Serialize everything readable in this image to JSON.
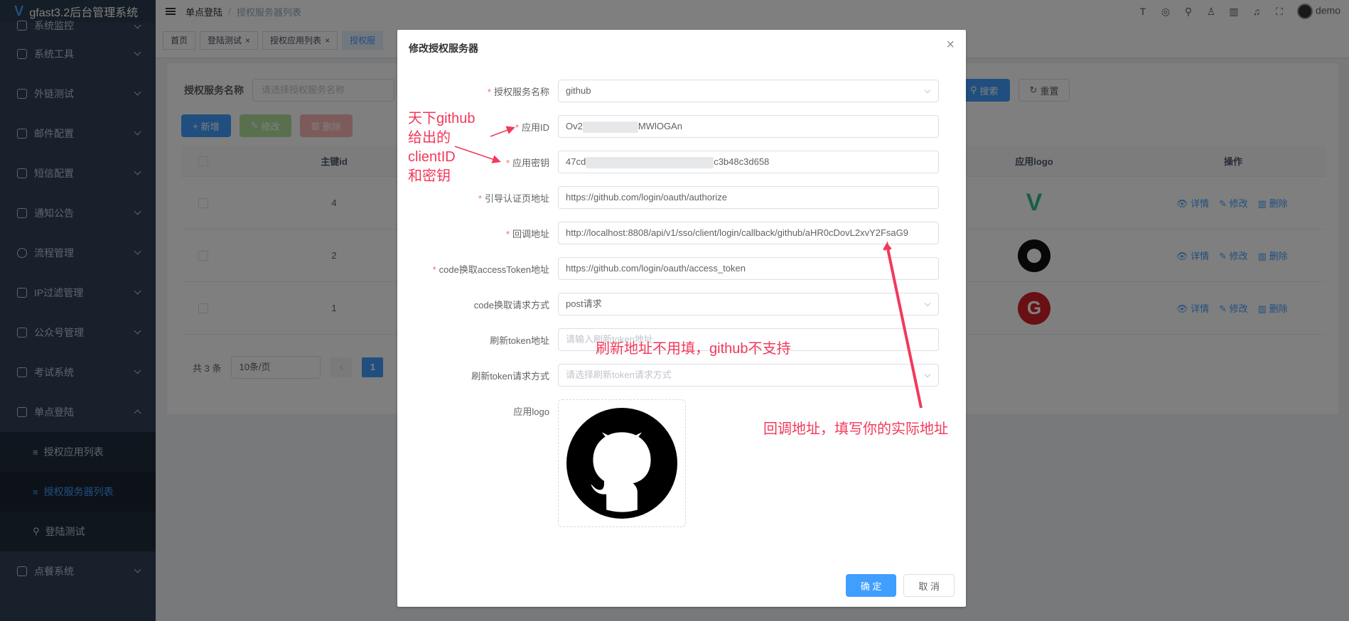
{
  "app": {
    "title": "gfast3.2后台管理系统"
  },
  "sidebar": {
    "items": [
      {
        "label": "系统监控"
      },
      {
        "label": "系统工具"
      },
      {
        "label": "外链测试"
      },
      {
        "label": "邮件配置"
      },
      {
        "label": "短信配置"
      },
      {
        "label": "通知公告"
      },
      {
        "label": "流程管理"
      },
      {
        "label": "IP过滤管理"
      },
      {
        "label": "公众号管理"
      },
      {
        "label": "考试系统"
      },
      {
        "label": "单点登陆"
      }
    ],
    "sub_items": [
      {
        "label": "授权应用列表"
      },
      {
        "label": "授权服务器列表"
      },
      {
        "label": "登陆测试"
      }
    ],
    "last_item": {
      "label": "点餐系统"
    }
  },
  "breadcrumb": {
    "parent": "单点登陆",
    "sep": "/",
    "current": "授权服务器列表"
  },
  "header": {
    "user": "demo"
  },
  "tags": [
    {
      "label": "首页"
    },
    {
      "label": "登陆测试"
    },
    {
      "label": "授权应用列表"
    },
    {
      "label": "授权服"
    }
  ],
  "search": {
    "label": "授权服务名称",
    "placeholder": "请选择授权服务名称",
    "search_btn": "搜索",
    "reset_btn": "重置"
  },
  "toolbar": {
    "add": "新增",
    "edit": "修改",
    "delete": "删除"
  },
  "table": {
    "headers": {
      "id": "主键id",
      "logo": "应用logo",
      "ops": "操作"
    },
    "rows": [
      {
        "id": "4",
        "logo_letter": "V",
        "logo_color": "#2fbf8f"
      },
      {
        "id": "2",
        "logo_letter": "",
        "logo_color": "#111111"
      },
      {
        "id": "1",
        "logo_letter": "G",
        "logo_color": "#d22128"
      }
    ],
    "ops": {
      "detail": "详情",
      "edit": "修改",
      "delete": "删除"
    }
  },
  "pager": {
    "total": "共 3 条",
    "size": "10条/页",
    "page": "1"
  },
  "dialog": {
    "title": "修改授权服务器",
    "fields": {
      "service_name": {
        "label": "授权服务名称",
        "value": "github"
      },
      "app_id": {
        "label": "应用ID",
        "value_pre": "Ov2",
        "value_post": "MWlOGAn"
      },
      "app_secret": {
        "label": "应用密钥",
        "value_pre": "47cd",
        "value_post": "c3b48c3d658"
      },
      "auth_url": {
        "label": "引导认证页地址",
        "value": "https://github.com/login/oauth/authorize"
      },
      "callback_url": {
        "label": "回调地址",
        "value": "http://localhost:8808/api/v1/sso/client/login/callback/github/aHR0cDovL2xvY2FsaG9"
      },
      "token_url": {
        "label": "code换取accessToken地址",
        "value": "https://github.com/login/oauth/access_token"
      },
      "token_method": {
        "label": "code换取请求方式",
        "value": "post请求"
      },
      "refresh_url": {
        "label": "刷新token地址",
        "placeholder": "请输入刷新token地址"
      },
      "refresh_method": {
        "label": "刷新token请求方式",
        "placeholder": "请选择刷新token请求方式"
      },
      "logo": {
        "label": "应用logo"
      }
    },
    "confirm": "确 定",
    "cancel": "取 消"
  },
  "annotations": {
    "client_id": [
      "天下github",
      "给出的",
      "clientID",
      "和密钥"
    ],
    "refresh": "刷新地址不用填，github不支持",
    "callback": "回调地址，填写你的实际地址"
  },
  "colors": {
    "primary": "#409eff",
    "sidebar": "#304156",
    "annotation": "#f3385a",
    "required": "#f56c6c"
  }
}
